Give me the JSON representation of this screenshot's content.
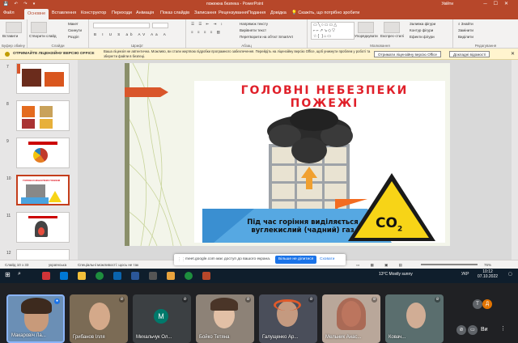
{
  "window": {
    "title": "пожежна безпека",
    "app": "PowerPoint",
    "user": "Увійти",
    "qat": "💾 ↶ ↷ ▾"
  },
  "tabs": [
    "Файл",
    "Основне",
    "Вставлення",
    "Конструктор",
    "Переходи",
    "Анімація",
    "Показ слайдів",
    "Записання",
    "Рецензування",
    "Подання",
    "Довідка"
  ],
  "tell_me": "Скажіть, що потрібно зробити",
  "ribbon": {
    "paste": "Вставити",
    "clipboard_label": "Буфер обміну",
    "new_slide": "Створити слайд",
    "layout": "Макет",
    "reset": "Скинути",
    "section": "Розділ",
    "slides_label": "Слайди",
    "font_label": "Шрифт",
    "text_direction": "Напрямок тексту",
    "align_text": "Вирівняти текст",
    "smartart": "Перетворити на об'єкт SmartArt",
    "paragraph_label": "Абзац",
    "arrange": "Упорядкувати",
    "quick_styles": "Експрес-стилі",
    "shape_fill": "Заливка фігури",
    "shape_outline": "Контур фігури",
    "shape_effects": "Ефекти фігури",
    "drawing_label": "Малювання",
    "find": "Знайти",
    "replace": "Замінити",
    "select": "Виділити",
    "editing_label": "Редагування"
  },
  "infobar": {
    "title": "ОТРИМАЙТЕ ЛІЦЕНЗІЙНУ ВЕРСІЮ OFFICE",
    "message": "Ваша ліцензія не автентична. Можливо, ви стали жертвою підробки програмного забезпечення. Перейдіть на ліцензійну версію Office, щоб уникнути проблем у роботі та зберегти файли в безпеці.",
    "button_get": "Отримати ліцензійну версію Office",
    "button_more": "Докладні відомості"
  },
  "thumbnails": [
    {
      "num": "7"
    },
    {
      "num": "8"
    },
    {
      "num": "9"
    },
    {
      "num": "10",
      "caption": "ГОЛОВНІ НЕБЕЗПЕКИ ПОЖЕЖІ"
    },
    {
      "num": "11"
    },
    {
      "num": "12"
    }
  ],
  "slide": {
    "title": "ГОЛОВНІ НЕБЕЗПЕКИ ПОЖЕЖІ",
    "caption_line1": "Під час горіння виділяється",
    "caption_line2": "вуглекислий (чадний) газ",
    "co2_label": "CO",
    "co2_sub": "2"
  },
  "status": {
    "slide_counter": "Слайд 10 з 33",
    "language": "українська",
    "accessibility": "Спеціальні можливості: щось не так",
    "zoom": "76%"
  },
  "share_banner": {
    "message": "meet.google.com має доступ до вашого екрана.",
    "stop": "Більше не ділитися",
    "hide": "Сховати"
  },
  "taskbar": {
    "weather": "13°C Mostly sunny",
    "lang": "УКР",
    "time": "10:12",
    "date": "07.10.2022"
  },
  "participants": [
    {
      "name": "Макаровіч Ла...",
      "active": true
    },
    {
      "name": "Грибанов Ілля",
      "active": false
    },
    {
      "name": "Михальчук Ол...",
      "initial": "M",
      "active": false
    },
    {
      "name": "Бойко Тетяна",
      "active": false
    },
    {
      "name": "Галущенко Ар...",
      "active": false
    },
    {
      "name": "Мельник Анас...",
      "active": false
    },
    {
      "name": "Ковач...",
      "active": false
    }
  ],
  "controls": {
    "avatars": [
      "Т",
      "Д"
    ],
    "me_label": "Ви"
  },
  "colors": {
    "accent": "#b7472a",
    "title_red": "#e0202a",
    "arrow_red": "#d9562b",
    "warning_yellow": "#f7d417"
  }
}
